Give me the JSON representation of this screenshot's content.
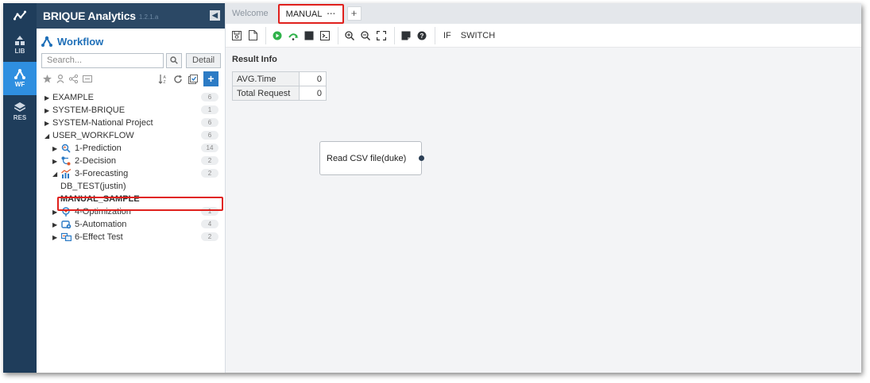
{
  "rail": {
    "items": [
      {
        "label": "LIB"
      },
      {
        "label": "WF"
      },
      {
        "label": "RES"
      }
    ]
  },
  "panel": {
    "brand": "BRIQUE Analytics",
    "version": "1.2.1.a",
    "section_title": "Workflow",
    "search_placeholder": "Search...",
    "detail_label": "Detail",
    "add_label": "+"
  },
  "tree": [
    {
      "label": "EXAMPLE",
      "count": "6"
    },
    {
      "label": "SYSTEM-BRIQUE",
      "count": "1"
    },
    {
      "label": "SYSTEM-National Project",
      "count": "6"
    },
    {
      "label": "USER_WORKFLOW",
      "count": "6"
    },
    {
      "label": "1-Prediction",
      "count": "14"
    },
    {
      "label": "2-Decision",
      "count": "2"
    },
    {
      "label": "3-Forecasting",
      "count": "2"
    },
    {
      "label": "DB_TEST(justin)"
    },
    {
      "label": "MANUAL_SAMPLE"
    },
    {
      "label": "4-Optimization",
      "count": "1"
    },
    {
      "label": "5-Automation",
      "count": "4"
    },
    {
      "label": "6-Effect Test",
      "count": "2"
    }
  ],
  "tabs": {
    "welcome": "Welcome",
    "manual": "MANUAL",
    "manual_menu": "···",
    "add": "+"
  },
  "toolbar": {
    "if_label": "IF",
    "switch_label": "SWITCH"
  },
  "result": {
    "title": "Result Info",
    "rows": [
      {
        "key": "AVG.Time",
        "value": "0"
      },
      {
        "key": "Total Request",
        "value": "0"
      }
    ]
  },
  "canvas_node": {
    "label": "Read CSV file(duke)"
  },
  "colors": {
    "rail_bg": "#1f3d5b",
    "rail_active": "#2f8fe0",
    "header_bg": "#2b4865",
    "accent": "#1e6fb8",
    "highlight": "#e0201c",
    "run_green": "#2fb24a"
  }
}
